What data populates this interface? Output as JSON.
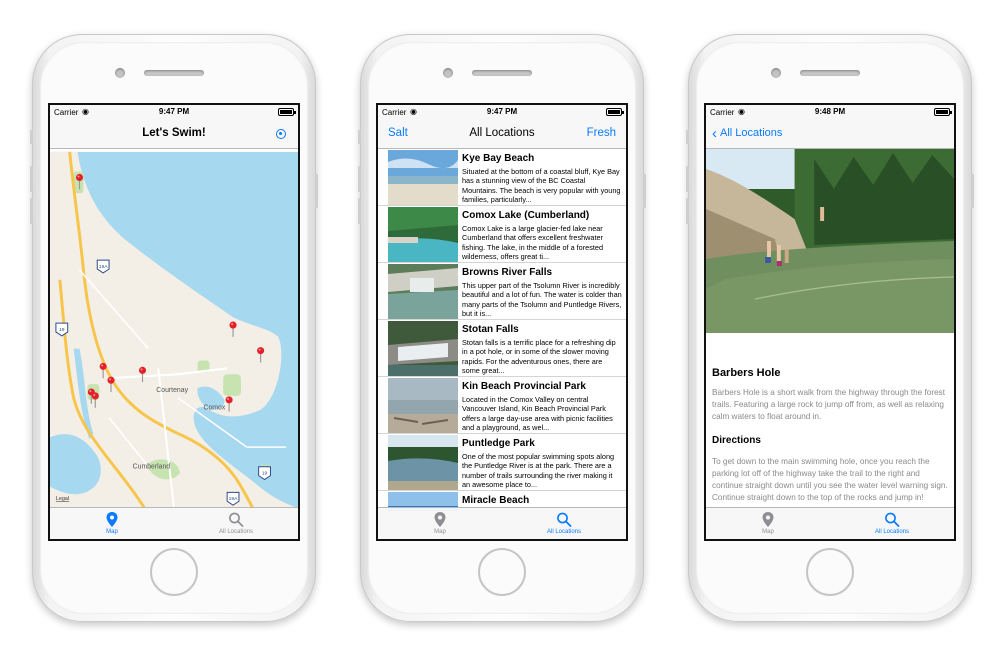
{
  "status_bars": [
    {
      "carrier": "Carrier",
      "time": "9:47 PM"
    },
    {
      "carrier": "Carrier",
      "time": "9:47 PM"
    },
    {
      "carrier": "Carrier",
      "time": "9:48 PM"
    }
  ],
  "map_screen": {
    "title": "Let's Swim!",
    "map_labels": {
      "courtenay": "Courtenay",
      "comox": "Comox",
      "cumberland": "Cumberland",
      "legal": "Legal"
    },
    "highway_signs": [
      "19A",
      "19",
      "19",
      "19A"
    ],
    "pin_count": 9
  },
  "list_screen": {
    "left_button": "Salt",
    "title": "All Locations",
    "right_button": "Fresh",
    "items": [
      {
        "title": "Kye Bay Beach",
        "desc": "Situated at the bottom of a coastal bluff, Kye Bay has a stunning view of the BC Coastal Mountains. The beach is very popular with young families, particularly..."
      },
      {
        "title": "Comox Lake (Cumberland)",
        "desc": "Comox Lake is a large glacier-fed lake near Cumberland that offers excellent freshwater fishing. The lake, in the middle of a forested wilderness, offers great ti..."
      },
      {
        "title": "Browns River Falls",
        "desc": "This upper part of the Tsolumn River is incredibly beautiful and a lot of fun. The water is colder than many parts of the Tsolumn and Puntledge Rivers, but it is..."
      },
      {
        "title": "Stotan Falls",
        "desc": "Stotan falls is a terrific place for a refreshing dip in a pot hole, or in some of the slower moving rapids. For the adventurous ones, there are some great..."
      },
      {
        "title": "Kin Beach Provincial Park",
        "desc": "Located in the Comox Valley on central Vancouver Island, Kin Beach Provincial Park offers a large day-use area with picnic facilities and a playground, as wel..."
      },
      {
        "title": "Puntledge Park",
        "desc": "One of the most popular swimming spots along the Puntledge River is at the park. There are a number of trails surrounding the river making it an awesome place to..."
      },
      {
        "title": "Miracle Beach",
        "desc": ""
      }
    ]
  },
  "detail_screen": {
    "back_label": "All Locations",
    "title": "Barbers Hole",
    "description": "Barbers Hole is a short walk from the highway through the forest trails. Featuring a large rock to jump off from, as well as relaxing calm waters to float around in.",
    "directions_heading": "Directions",
    "directions": "To get down to the main swimming hole, once you reach the parking lot off of the highway take the trail to the right and continue straight down until you see the water level warning sign. Continue straight down to the top of the rocks and jump in!"
  },
  "tabs": [
    {
      "label": "Map",
      "icon": "map-pin-icon"
    },
    {
      "label": "All Locations",
      "icon": "search-icon"
    }
  ],
  "colors": {
    "accent": "#0a7aff",
    "inactive": "#8e8e93",
    "water": "#a6d8f0",
    "land": "#f3efe6",
    "park": "#c6e3b0",
    "road": "#f6c54a",
    "pin": "#e4202a"
  }
}
